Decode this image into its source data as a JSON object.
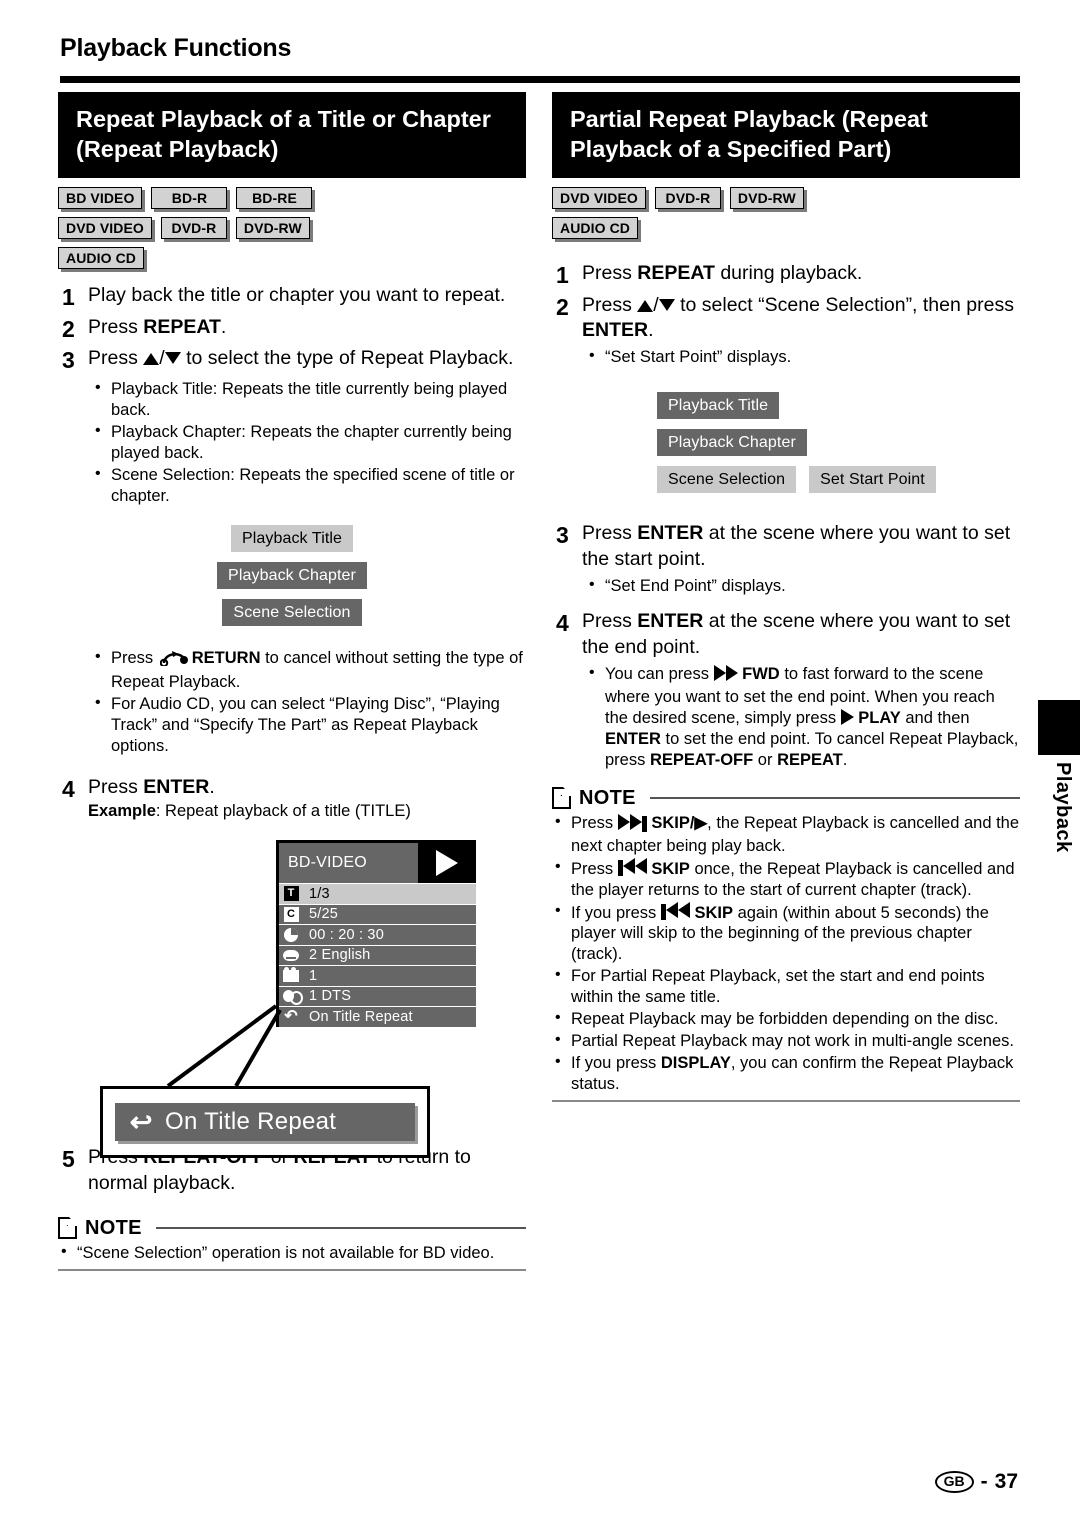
{
  "running_head": "Playback Functions",
  "left": {
    "title": "Repeat Playback of a Title or Chapter (Repeat Playback)",
    "badges": [
      [
        "BD VIDEO",
        "BD-R",
        "BD-RE"
      ],
      [
        "DVD VIDEO",
        "DVD-R",
        "DVD-RW"
      ],
      [
        "AUDIO CD"
      ]
    ],
    "step1_num": "1",
    "step1_text": "Play back the title or chapter you want to repeat.",
    "step2_num": "2",
    "step2_a": "Press ",
    "step2_b": "REPEAT",
    "step2_c": ".",
    "step3_num": "3",
    "step3_a": "Press ",
    "step3_b": " to select the type of Repeat Playback.",
    "step3_bullets": [
      "Playback Title: Repeats the title currently being played back.",
      "Playback Chapter: Repeats the chapter currently being played back.",
      "Scene Selection: Repeats the specified scene of title or chapter."
    ],
    "menu_chips": [
      {
        "label": "Playback Title",
        "state": "selected"
      },
      {
        "label": "Playback Chapter",
        "state": "unselected"
      },
      {
        "label": "Scene Selection",
        "state": "unselected"
      }
    ],
    "bullet_return_a": "Press ",
    "bullet_return_b": "RETURN",
    "bullet_return_c": " to cancel without setting the type of Repeat Playback.",
    "bullet_audiocd": "For Audio CD, you can select “Playing Disc”, “Playing Track” and “Specify The Part” as Repeat Playback options.",
    "step4_num": "4",
    "step4_a": "Press ",
    "step4_b": "ENTER",
    "step4_c": ".",
    "example_label": "Example",
    "example_text": ": Repeat playback of a title (TITLE)",
    "osd": {
      "header": "BD-VIDEO",
      "rows": [
        {
          "icon": "title-icon",
          "glyph": "T",
          "value": "1/3",
          "highlight": true
        },
        {
          "icon": "chapter-icon",
          "glyph": "C",
          "value": "5/25",
          "highlight": false
        },
        {
          "icon": "time-icon",
          "glyph": "",
          "value": "00 : 20 : 30",
          "highlight": false
        },
        {
          "icon": "subtitle-icon",
          "glyph": "",
          "value": "2 English",
          "highlight": false
        },
        {
          "icon": "angle-icon",
          "glyph": "",
          "value": "1",
          "highlight": false
        },
        {
          "icon": "audio-icon",
          "glyph": "",
          "value": "1 DTS",
          "highlight": false
        },
        {
          "icon": "repeat-icon",
          "glyph": "↶",
          "value": "On Title Repeat",
          "highlight": false
        }
      ]
    },
    "callout_text": "On Title Repeat",
    "callout_icon": "repeat-icon",
    "step5_num": "5",
    "step5_a": "Press ",
    "step5_b": "REPEAT-OFF",
    "step5_c": " or ",
    "step5_d": "REPEAT",
    "step5_e": " to return to normal playback.",
    "note_title": "NOTE",
    "note_bullets": [
      "“Scene Selection” operation is not available for BD video."
    ]
  },
  "right": {
    "title": "Partial Repeat Playback (Repeat Playback of a Specified Part)",
    "badges": [
      [
        "DVD VIDEO",
        "DVD-R",
        "DVD-RW"
      ],
      [
        "AUDIO CD"
      ]
    ],
    "step1_num": "1",
    "step1_a": "Press ",
    "step1_b": "REPEAT",
    "step1_c": " during playback.",
    "step2_num": "2",
    "step2_a": "Press ",
    "step2_b": " to select “Scene Selection”, then press ",
    "step2_c": "ENTER",
    "step2_d": ".",
    "step2_bullet": "“Set Start Point” displays.",
    "menu_chips": [
      {
        "label": "Playback Title",
        "state": "unselected"
      },
      {
        "label": "Playback Chapter",
        "state": "unselected"
      },
      {
        "label": "Scene Selection",
        "state": "selected"
      },
      {
        "label": "Set Start Point",
        "state": "selected"
      }
    ],
    "step3_num": "3",
    "step3_a": "Press ",
    "step3_b": "ENTER",
    "step3_c": " at the scene where you want to set the start point.",
    "step3_bullet": "“Set End Point” displays.",
    "step4_num": "4",
    "step4_a": "Press ",
    "step4_b": "ENTER",
    "step4_c": " at the scene where you want to set the end point.",
    "step4_bullet_1": "You can press ",
    "step4_bullet_2": "FWD",
    "step4_bullet_3": " to fast forward to the scene where you want to set the end point. When you reach the desired scene, simply press ",
    "step4_bullet_4": "PLAY",
    "step4_bullet_5": " and then ",
    "step4_bullet_6": "ENTER",
    "step4_bullet_7": " to set the end point. To cancel Repeat Playback, press ",
    "step4_bullet_8": "REPEAT-OFF",
    "step4_bullet_9": " or ",
    "step4_bullet_10": "REPEAT",
    "step4_bullet_11": ".",
    "note_title": "NOTE",
    "note_b1_a": "Press ",
    "note_b1_b": "SKIP/",
    "note_b1_c": ", the Repeat Playback is cancelled and the next chapter being play back.",
    "note_b2_a": "Press ",
    "note_b2_b": "SKIP",
    "note_b2_c": " once, the Repeat Playback is cancelled and the player returns to the start of current chapter (track).",
    "note_b3_a": "If you press ",
    "note_b3_b": "SKIP",
    "note_b3_c": " again (within about 5 seconds) the player will skip to the beginning of the previous chapter (track).",
    "note_b4": "For Partial Repeat Playback, set the start and end points within the same title.",
    "note_b5": "Repeat Playback may be forbidden depending on the disc.",
    "note_b6": "Partial Repeat Playback may not work in multi-angle scenes.",
    "note_b7_a": "If you press ",
    "note_b7_b": "DISPLAY",
    "note_b7_c": ", you can confirm the Repeat Playback status."
  },
  "side_tab_label": "Playback",
  "footer": {
    "region": "GB",
    "separator": "-",
    "page": "37"
  }
}
